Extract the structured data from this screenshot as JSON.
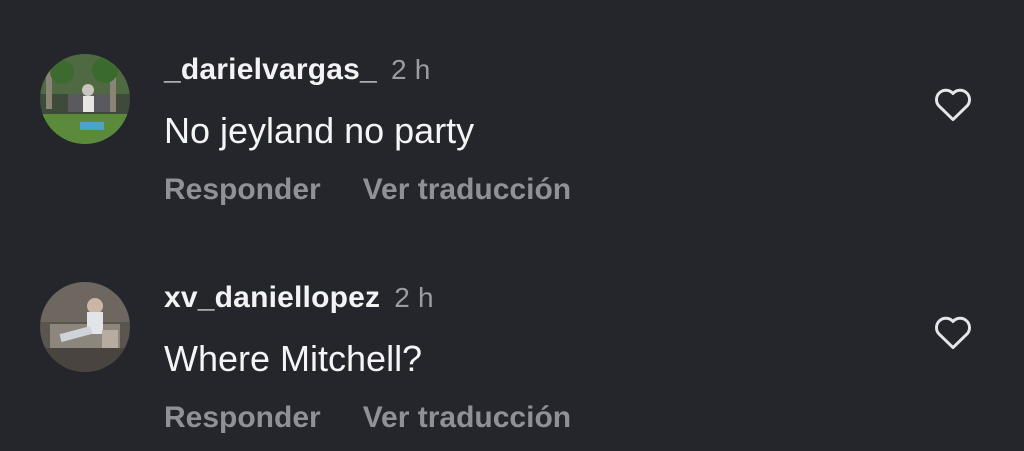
{
  "comments": [
    {
      "username": "_darielvargas_",
      "time": "2 h",
      "text": "No jeyland no party",
      "reply_label": "Responder",
      "translate_label": "Ver traducción",
      "like_icon": "heart-outline-icon"
    },
    {
      "username": "xv_daniellopez",
      "time": "2 h",
      "text": "Where Mitchell?",
      "reply_label": "Responder",
      "translate_label": "Ver traducción",
      "like_icon": "heart-outline-icon"
    }
  ],
  "colors": {
    "background": "#25262b",
    "primary_text": "#f3f3f5",
    "secondary_text": "#8f9198"
  }
}
